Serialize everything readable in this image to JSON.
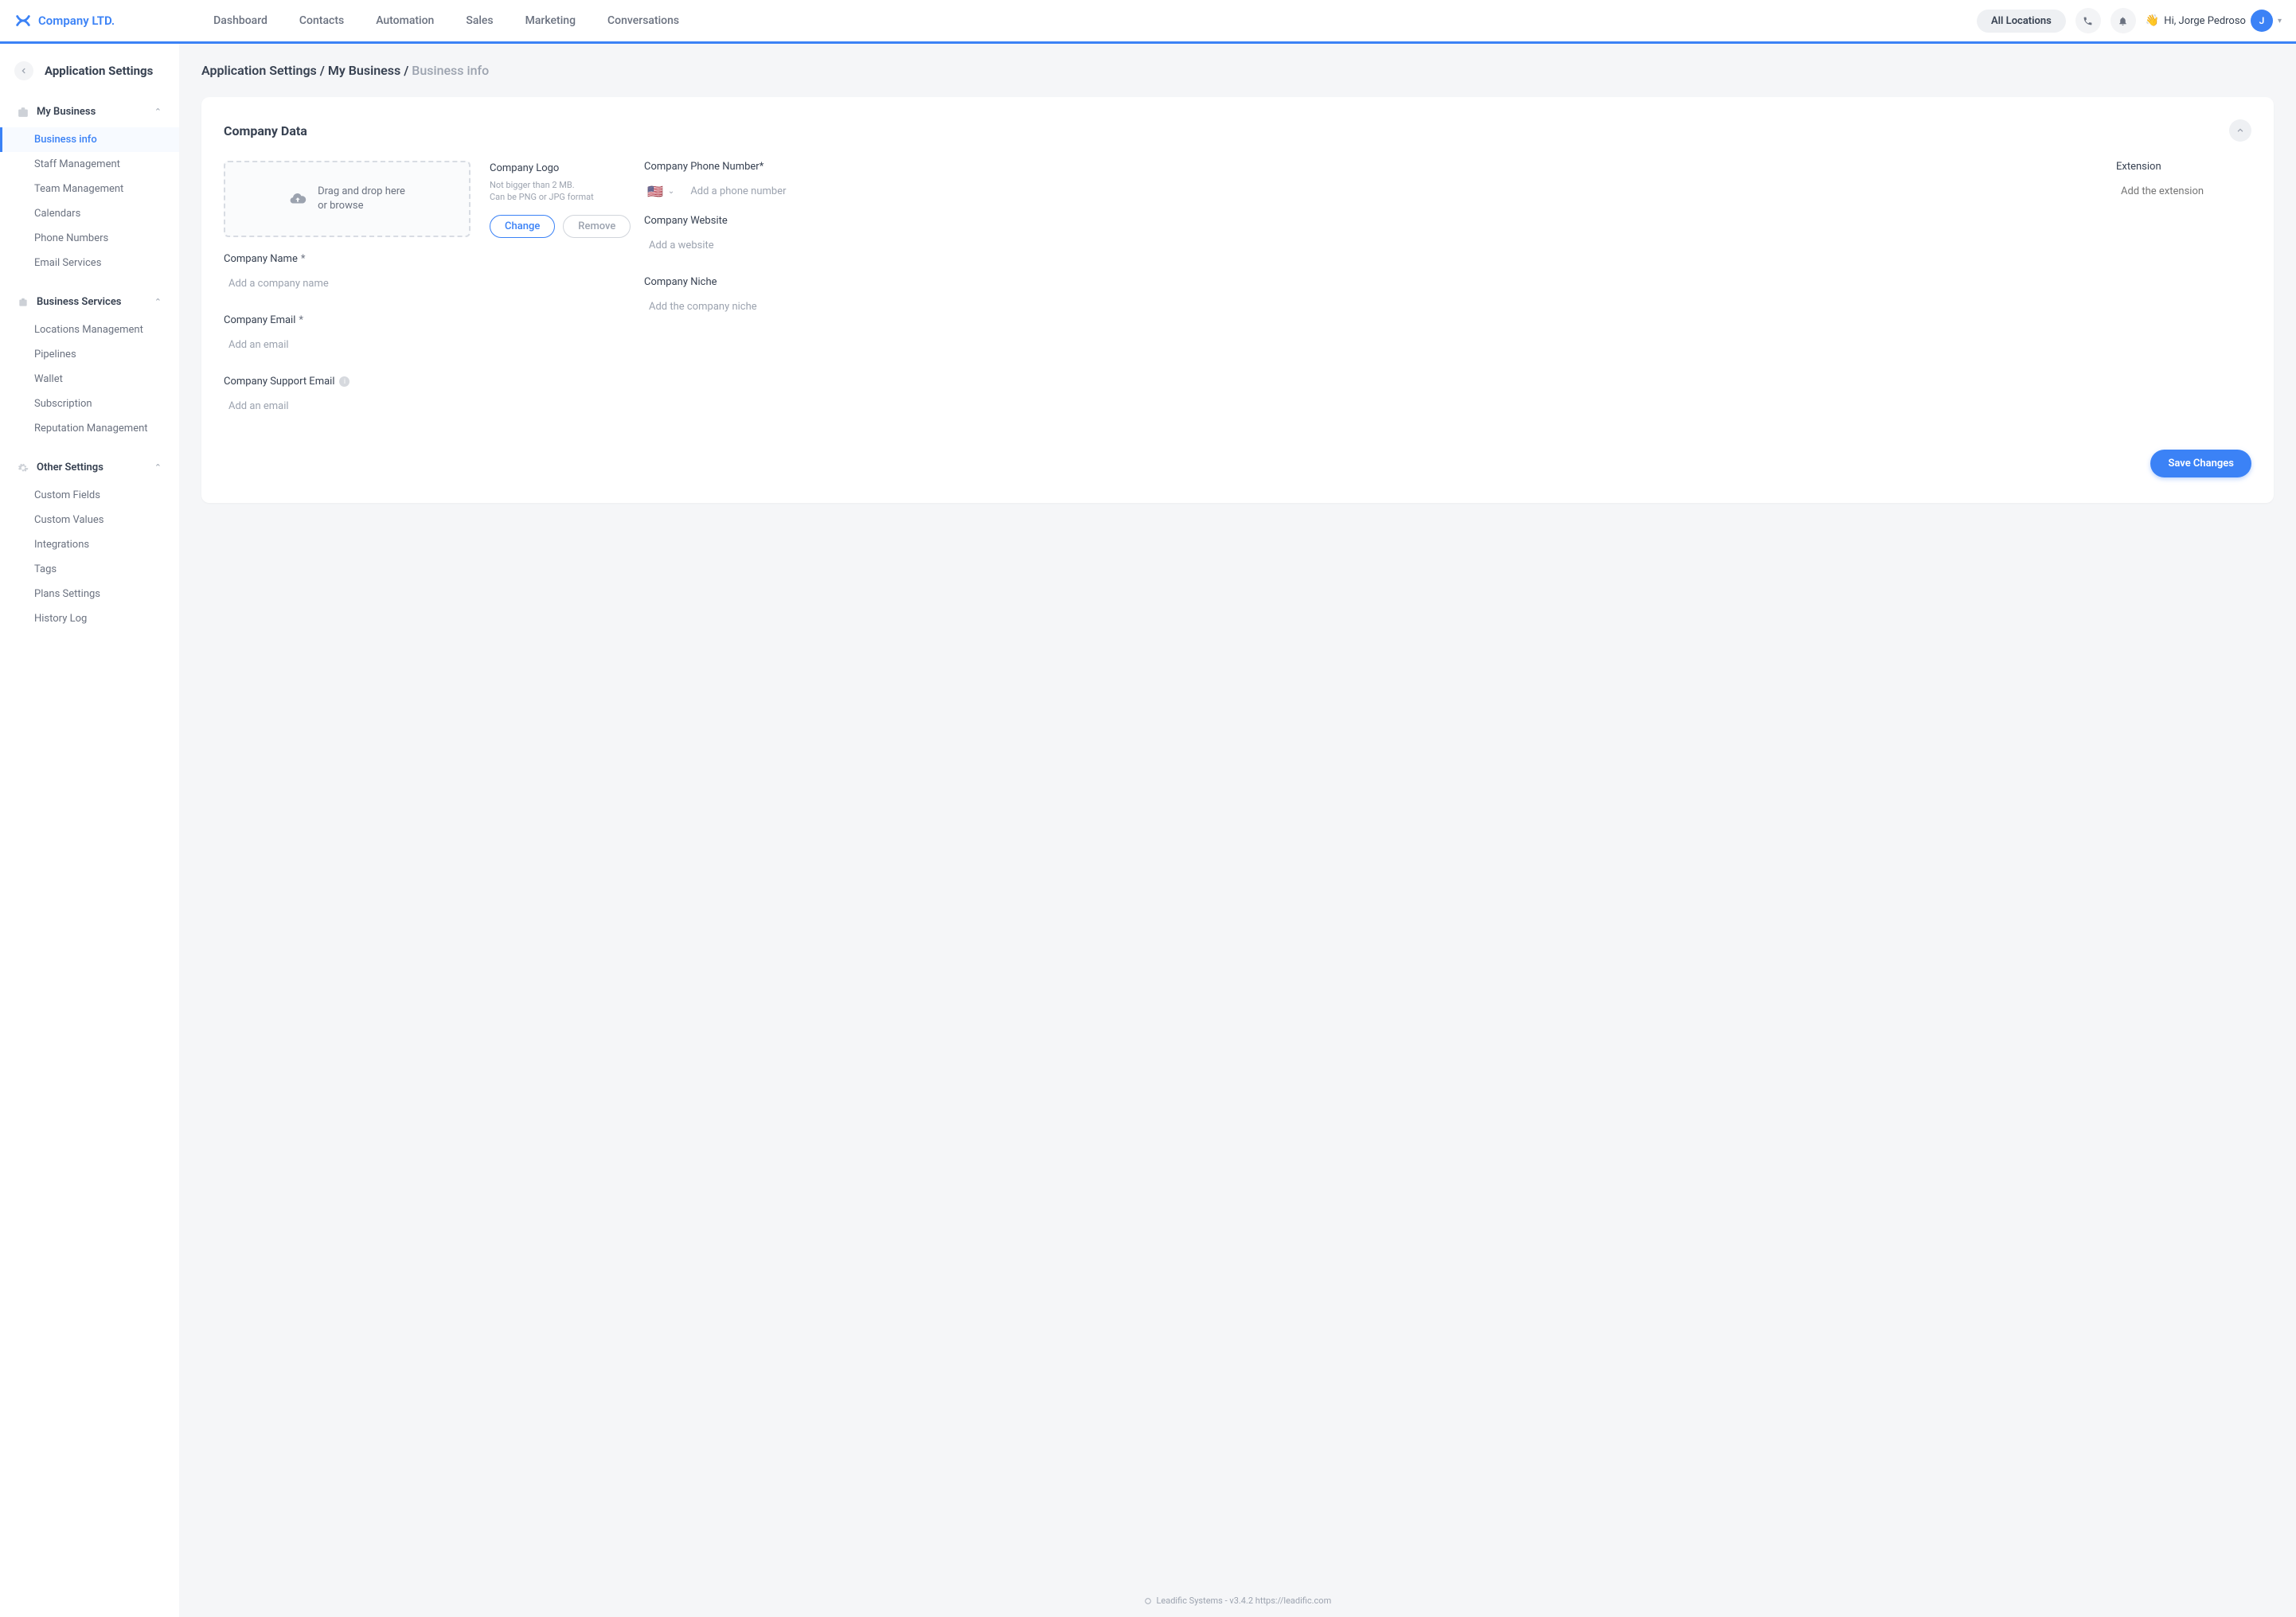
{
  "brand": "Company LTD.",
  "nav": {
    "links": [
      "Dashboard",
      "Contacts",
      "Automation",
      "Sales",
      "Marketing",
      "Conversations"
    ],
    "locations_pill": "All Locations",
    "greeting": "Hi, Jorge Pedroso",
    "avatar_initial": "J"
  },
  "sidebar": {
    "title": "Application Settings",
    "sections": [
      {
        "label": "My Business",
        "items": [
          "Business info",
          "Staff Management",
          "Team Management",
          "Calendars",
          "Phone Numbers",
          "Email Services"
        ],
        "active_index": 0
      },
      {
        "label": "Business Services",
        "items": [
          "Locations Management",
          "Pipelines",
          "Wallet",
          "Subscription",
          "Reputation Management"
        ]
      },
      {
        "label": "Other Settings",
        "items": [
          "Custom Fields",
          "Custom Values",
          "Integrations",
          "Tags",
          "Plans Settings",
          "History Log"
        ]
      }
    ]
  },
  "breadcrumb": {
    "a": "Application Settings",
    "b": "My Business",
    "c": "Business info",
    "sep": " / "
  },
  "card": {
    "title": "Company Data",
    "dropzone": {
      "line1": "Drag and drop here",
      "line2": "or browse"
    },
    "logo": {
      "label": "Company Logo",
      "hint1": "Not bigger than 2 MB.",
      "hint2": "Can be PNG or JPG format",
      "change": "Change",
      "remove": "Remove"
    },
    "company_name": {
      "label": "Company Name",
      "placeholder": "Add a company name"
    },
    "company_email": {
      "label": "Company Email",
      "placeholder": "Add an email"
    },
    "support_email": {
      "label": "Company Support Email",
      "placeholder": "Add an email"
    },
    "phone": {
      "label": "Company Phone Number*",
      "placeholder": "Add a phone number",
      "flag": "🇺🇸"
    },
    "ext": {
      "label": "Extension",
      "placeholder": "Add the extension"
    },
    "website": {
      "label": "Company Website",
      "placeholder": "Add a website"
    },
    "niche": {
      "label": "Company Niche",
      "placeholder": "Add the company niche"
    },
    "save": "Save Changes"
  },
  "footer": {
    "company": "Leadific Systems",
    "version": "v3.4.2",
    "url": "https://leadific.com"
  }
}
